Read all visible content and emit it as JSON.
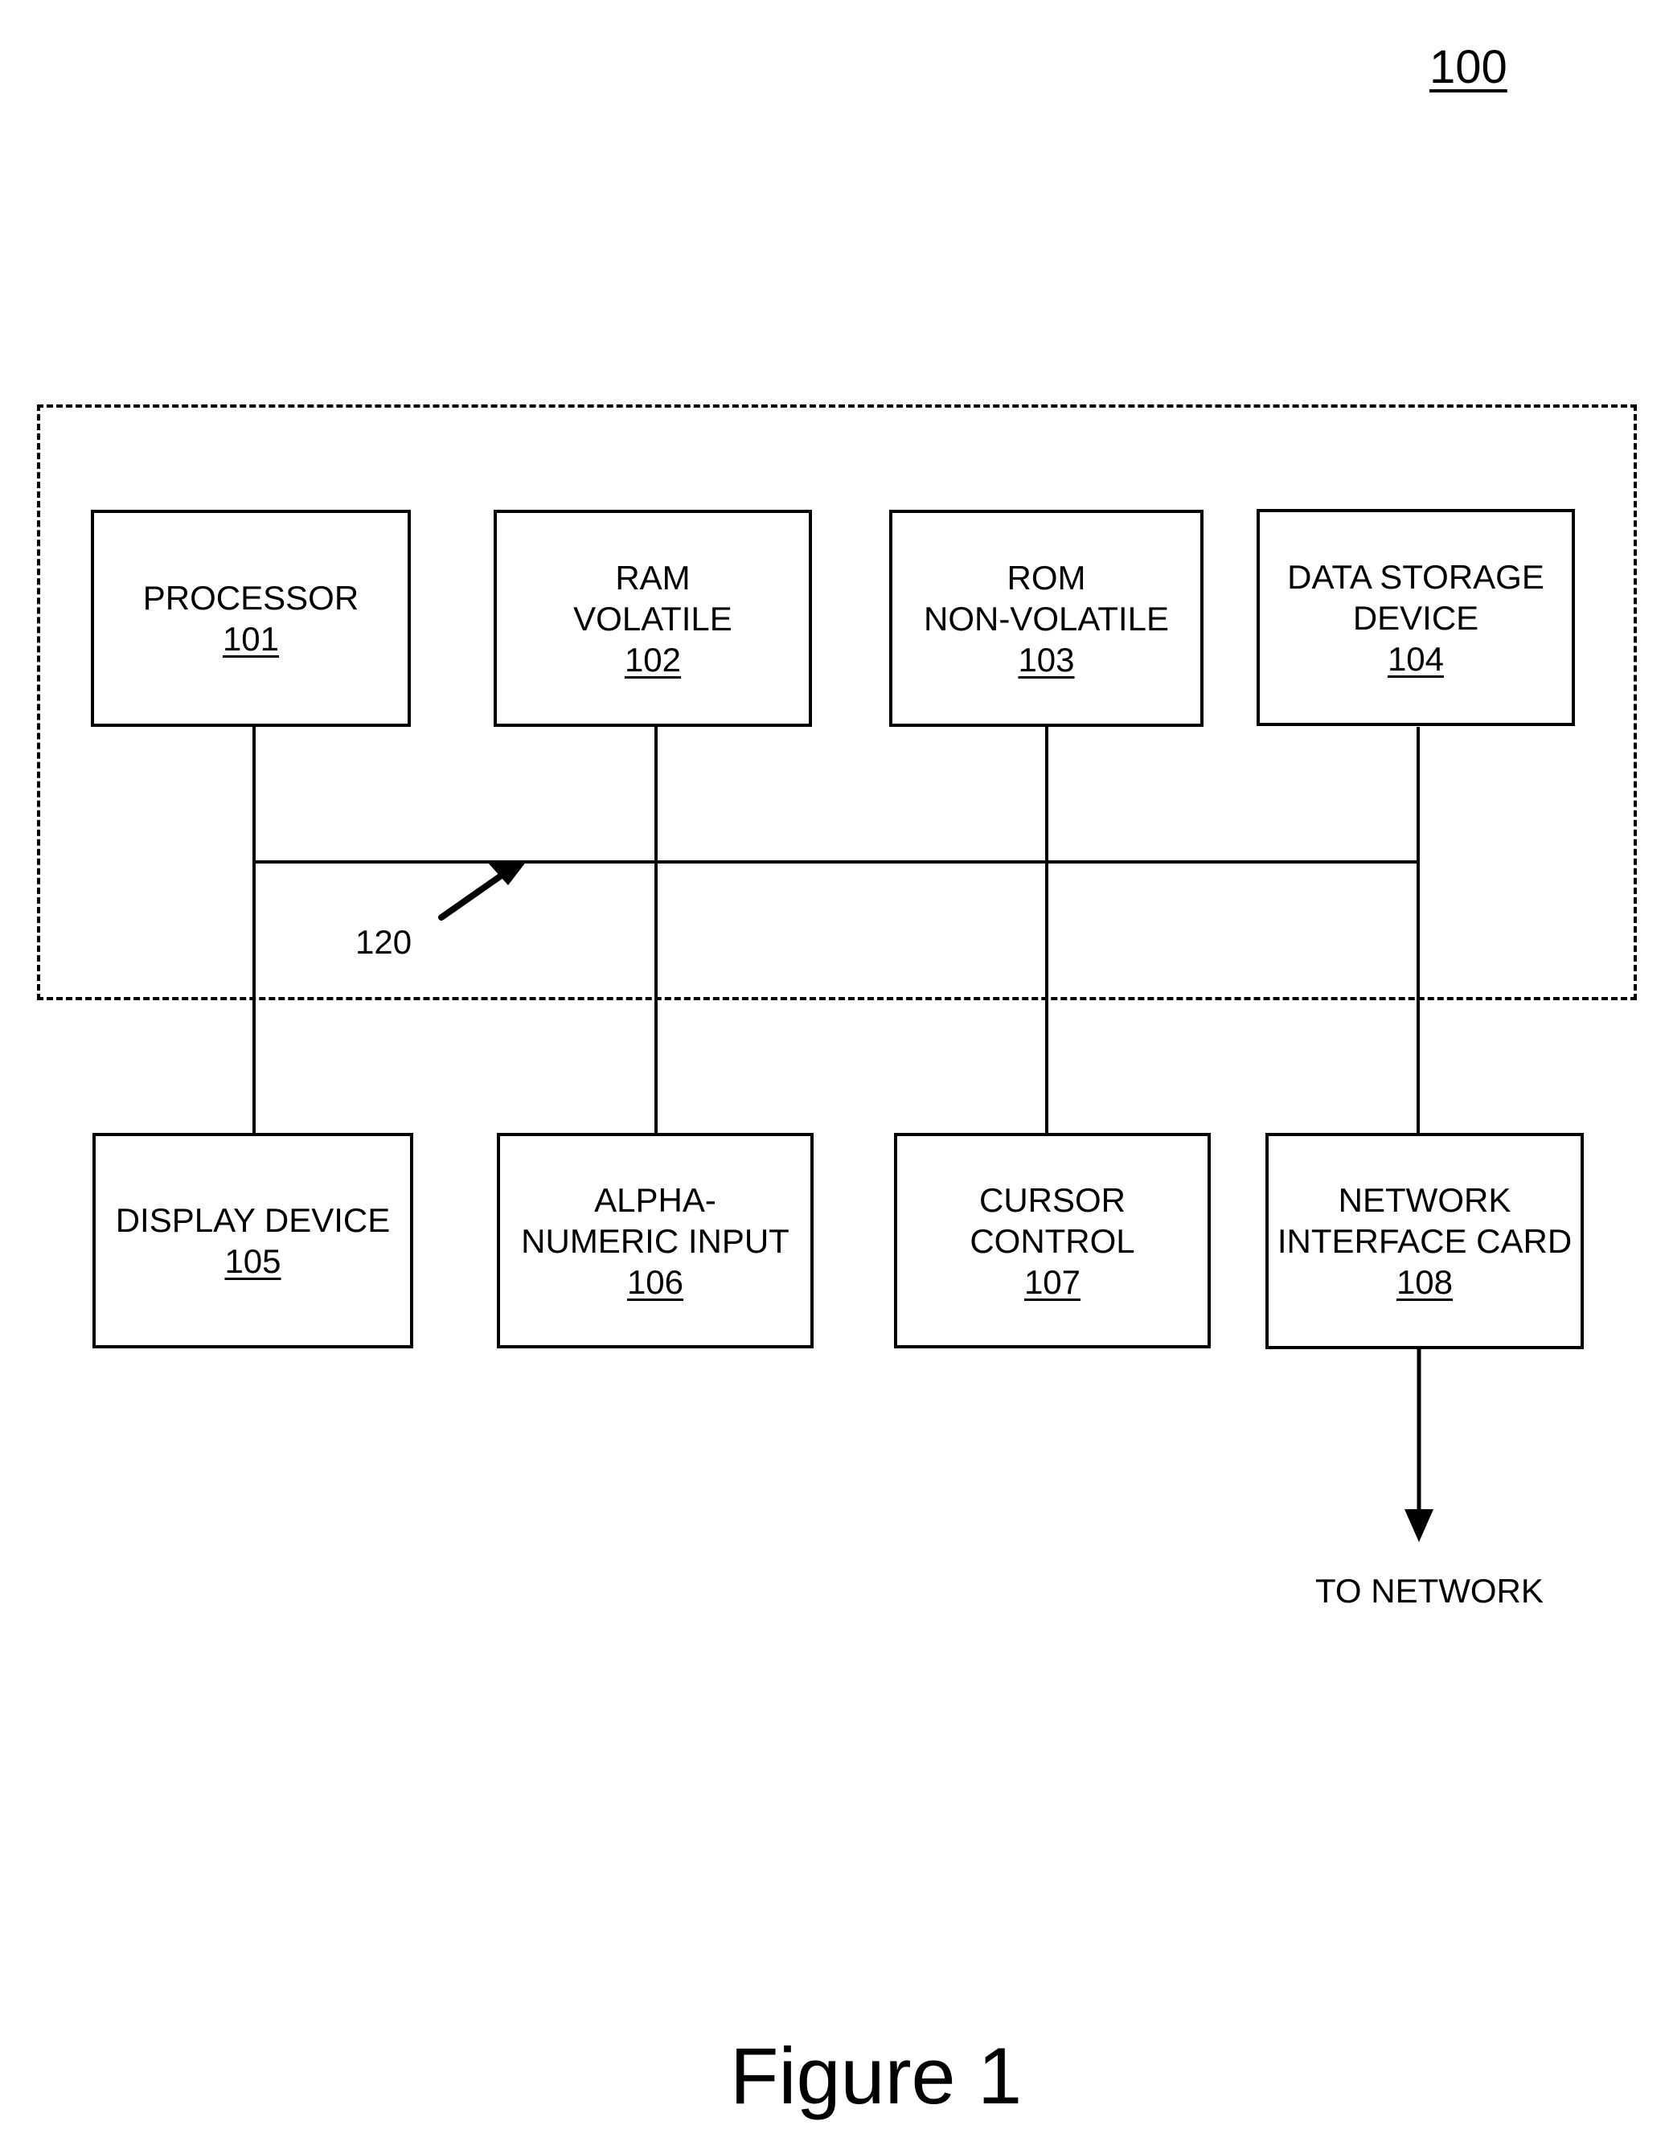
{
  "figure": {
    "reference_number": "100",
    "caption": "Figure 1",
    "bus_label": "120",
    "network_label": "TO NETWORK"
  },
  "system_components": [
    {
      "lines": [
        "PROCESSOR"
      ],
      "ref": "101"
    },
    {
      "lines": [
        "RAM",
        "VOLATILE"
      ],
      "ref": "102"
    },
    {
      "lines": [
        "ROM",
        "NON-VOLATILE"
      ],
      "ref": "103"
    },
    {
      "lines": [
        "DATA STORAGE",
        "DEVICE"
      ],
      "ref": "104"
    }
  ],
  "peripheral_components": [
    {
      "lines": [
        "DISPLAY DEVICE"
      ],
      "ref": "105"
    },
    {
      "lines": [
        "ALPHA-",
        "NUMERIC INPUT"
      ],
      "ref": "106"
    },
    {
      "lines": [
        "CURSOR",
        "CONTROL"
      ],
      "ref": "107"
    },
    {
      "lines": [
        "NETWORK",
        "INTERFACE CARD"
      ],
      "ref": "108"
    }
  ]
}
